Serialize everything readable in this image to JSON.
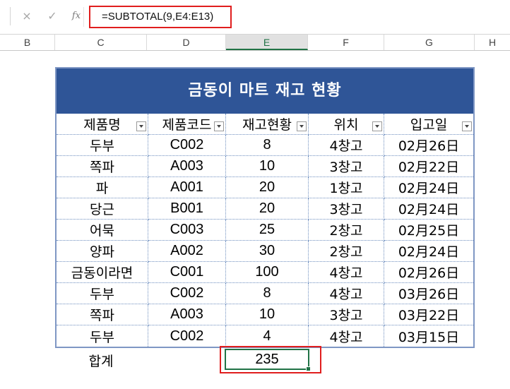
{
  "formula_bar": {
    "cancel_icon": "×",
    "enter_icon": "✓",
    "fx_label": "fx",
    "formula": "=SUBTOTAL(9,E4:E13)"
  },
  "columns": [
    "B",
    "C",
    "D",
    "E",
    "F",
    "G",
    "H"
  ],
  "active_column": "E",
  "table": {
    "title": "금동이 마트 재고 현황",
    "headers": [
      "제품명",
      "제품코드",
      "재고현황",
      "위치",
      "입고일"
    ],
    "rows": [
      [
        "두부",
        "C002",
        "8",
        "4창고",
        "02月26日"
      ],
      [
        "쪽파",
        "A003",
        "10",
        "3창고",
        "02月22日"
      ],
      [
        "파",
        "A001",
        "20",
        "1창고",
        "02月24日"
      ],
      [
        "당근",
        "B001",
        "20",
        "3창고",
        "02月24日"
      ],
      [
        "어묵",
        "C003",
        "25",
        "2창고",
        "02月25日"
      ],
      [
        "양파",
        "A002",
        "30",
        "2창고",
        "02月24日"
      ],
      [
        "금동이라면",
        "C001",
        "100",
        "4창고",
        "02月26日"
      ],
      [
        "두부",
        "C002",
        "8",
        "4창고",
        "03月26日"
      ],
      [
        "쪽파",
        "A003",
        "10",
        "3창고",
        "03月22日"
      ],
      [
        "두부",
        "C002",
        "4",
        "4창고",
        "03月15日"
      ]
    ]
  },
  "total": {
    "label": "합계",
    "value": "235"
  },
  "colors": {
    "title_bg": "#2f5597",
    "highlight": "#e01e1e",
    "selection": "#217346"
  }
}
